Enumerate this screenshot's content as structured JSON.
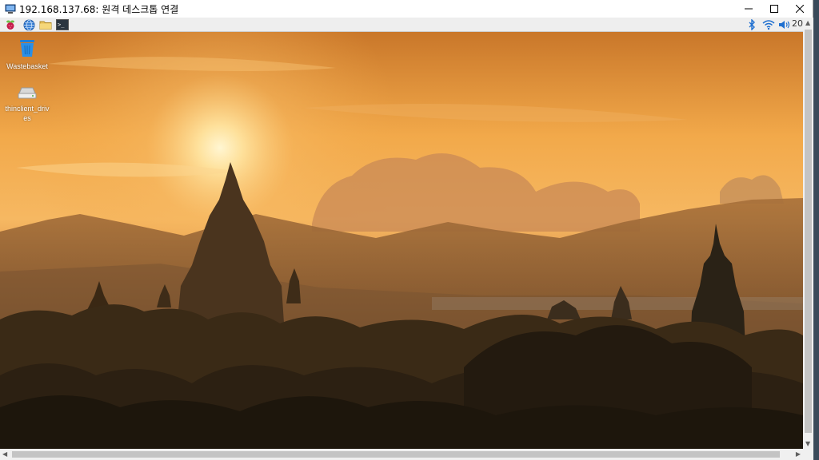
{
  "window": {
    "title": "192.168.137.68: 원격 데스크톱 연결",
    "controls": [
      "minimize",
      "maximize",
      "close"
    ]
  },
  "panel": {
    "launchers": [
      {
        "name": "raspberry-menu-icon"
      },
      {
        "name": "web-browser-icon"
      },
      {
        "name": "file-manager-icon"
      },
      {
        "name": "terminal-icon"
      }
    ],
    "tray": [
      {
        "name": "bluetooth-icon"
      },
      {
        "name": "wifi-icon"
      },
      {
        "name": "volume-icon"
      }
    ],
    "clock": "20"
  },
  "desktop": {
    "icons": [
      {
        "label": "Wastebasket",
        "icon": "wastebasket-icon"
      },
      {
        "label": "thinclient_drives",
        "icon": "drive-icon"
      }
    ]
  },
  "colors": {
    "panel": "#eeeeee",
    "titlebar": "#ffffff",
    "sky_top": "#f2a94a",
    "sun": "#fff3c4",
    "silhouette": "#2a2216"
  }
}
